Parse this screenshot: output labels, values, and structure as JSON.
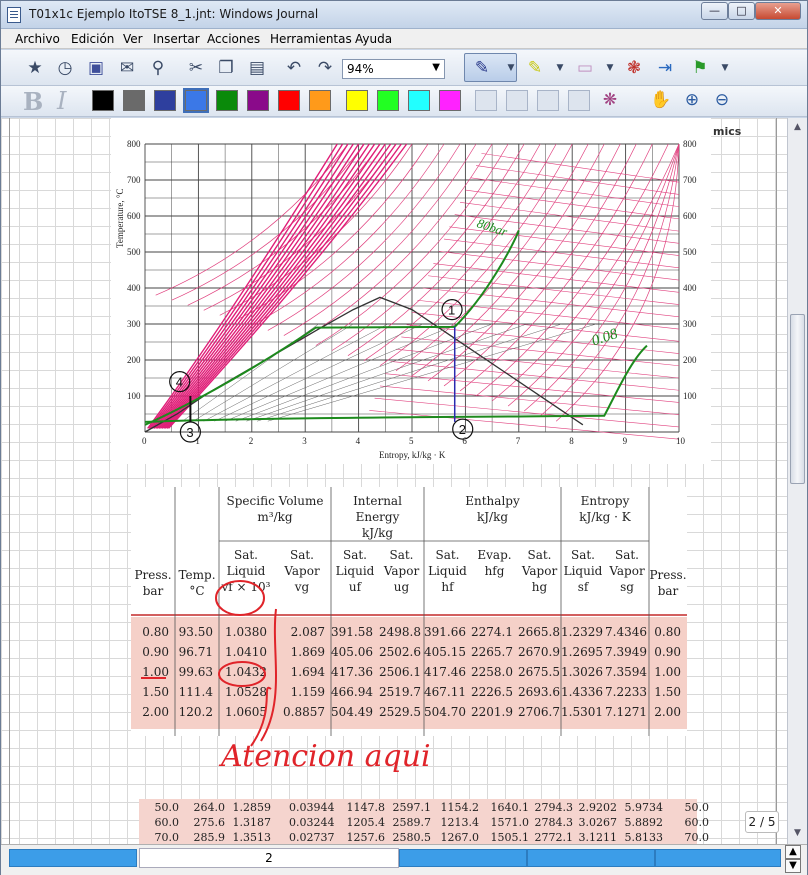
{
  "window": {
    "title": "T01x1c Ejemplo ItoTSE 8_1.jnt: Windows Journal"
  },
  "menu": [
    "Archivo",
    "Edición",
    "Ver",
    "Insertar",
    "Acciones",
    "Herramientas",
    "Ayuda"
  ],
  "toolbar": {
    "zoom": "94%"
  },
  "colors": [
    "#000000",
    "#6a6a6a",
    "#2e3f9e",
    "#3b78e7",
    "#0a8a0a",
    "#8a0a8a",
    "#ff0000",
    "#ff9a1a",
    "#ffff00",
    "#22ff22",
    "#22ffff",
    "#ff22ff"
  ],
  "chart_data": {
    "type": "line",
    "ylabel": "Temperature, °C",
    "xlabel": "Entropy, kJ/kg · K",
    "xlim": [
      0,
      10
    ],
    "ylim": [
      0,
      800
    ],
    "x_ticks": [
      "0",
      "1",
      "2",
      "3",
      "4",
      "5",
      "6",
      "7",
      "8",
      "9",
      "10"
    ],
    "y_ticks": [
      "100",
      "200",
      "300",
      "400",
      "500",
      "600",
      "700",
      "800"
    ],
    "right_y_ticks": [
      "100",
      "200",
      "300",
      "400",
      "500",
      "600",
      "700",
      "800"
    ],
    "dome_x": [
      0,
      0.6,
      1.2,
      1.9,
      2.6,
      3.3,
      3.9,
      4.4,
      5.0,
      5.6,
      6.2,
      6.9,
      7.6,
      8.2
    ],
    "dome_y": [
      0,
      50,
      110,
      170,
      230,
      290,
      340,
      374,
      340,
      280,
      220,
      150,
      80,
      20
    ],
    "annotation_points": [
      "1",
      "2",
      "3",
      "4"
    ],
    "annotation_texts": [
      "80bar",
      "0.08"
    ],
    "side_label": "mics"
  },
  "table": {
    "groups": [
      "Specific Volume\nm³/kg",
      "Internal Energy\nkJ/kg",
      "Enthalpy\nkJ/kg",
      "Entropy\nkJ/kg · K"
    ],
    "headers": [
      "Press.\nbar",
      "Temp.\n°C",
      "Sat.\nLiquid\nvf × 10³",
      "Sat.\nVapor\nvg",
      "Sat.\nLiquid\nuf",
      "Sat.\nVapor\nug",
      "Sat.\nLiquid\nhf",
      "Evap.\nhfg",
      "Sat.\nVapor\nhg",
      "Sat.\nLiquid\nsf",
      "Sat.\nVapor\nsg",
      "Press.\nbar"
    ],
    "rows": [
      [
        "0.80",
        "93.50",
        "1.0380",
        "2.087",
        "391.58",
        "2498.8",
        "391.66",
        "2274.1",
        "2665.8",
        "1.2329",
        "7.4346",
        "0.80"
      ],
      [
        "0.90",
        "96.71",
        "1.0410",
        "1.869",
        "405.06",
        "2502.6",
        "405.15",
        "2265.7",
        "2670.9",
        "1.2695",
        "7.3949",
        "0.90"
      ],
      [
        "1.00",
        "99.63",
        "1.0432",
        "1.694",
        "417.36",
        "2506.1",
        "417.46",
        "2258.0",
        "2675.5",
        "1.3026",
        "7.3594",
        "1.00"
      ],
      [
        "1.50",
        "111.4",
        "1.0528",
        "1.159",
        "466.94",
        "2519.7",
        "467.11",
        "2226.5",
        "2693.6",
        "1.4336",
        "7.2233",
        "1.50"
      ],
      [
        "2.00",
        "120.2",
        "1.0605",
        "0.8857",
        "504.49",
        "2529.5",
        "504.70",
        "2201.9",
        "2706.7",
        "1.5301",
        "7.1271",
        "2.00"
      ]
    ],
    "lower_rows": [
      [
        "50.0",
        "264.0",
        "1.2859",
        "0.03944",
        "1147.8",
        "2597.1",
        "1154.2",
        "1640.1",
        "2794.3",
        "2.9202",
        "5.9734",
        "50.0"
      ],
      [
        "60.0",
        "275.6",
        "1.3187",
        "0.03244",
        "1205.4",
        "2589.7",
        "1213.4",
        "1571.0",
        "2784.3",
        "3.0267",
        "5.8892",
        "60.0"
      ],
      [
        "70.0",
        "285.9",
        "1.3513",
        "0.02737",
        "1257.6",
        "2580.5",
        "1267.0",
        "1505.1",
        "2772.1",
        "3.1211",
        "5.8133",
        "70.0"
      ]
    ]
  },
  "handwriting": {
    "note": "Atencion aqui"
  },
  "status": {
    "page_field": "2",
    "page_indicator": "2 / 5"
  }
}
